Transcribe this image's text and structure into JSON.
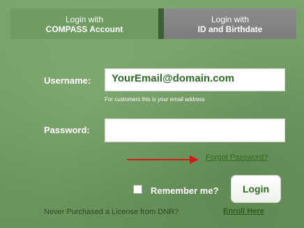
{
  "tabs": {
    "compass": {
      "line1": "Login with",
      "line2": "COMPASS Account"
    },
    "id_birthdate": {
      "line1": "Login with",
      "line2": "ID and Birthdate"
    }
  },
  "form": {
    "username_label": "Username:",
    "username_value": "YourEmail@domain.com",
    "username_hint": "For customers this is your email address",
    "password_label": "Password:",
    "password_value": "",
    "forgot_link": "Forgot Password?",
    "remember_label": "Remember me?",
    "remember_checked": false,
    "login_button": "Login"
  },
  "footer": {
    "prompt": "Never Purchased a License from DNR?",
    "enroll_link": "Enroll Here"
  },
  "colors": {
    "background": "#6e9761",
    "active_tab": "#709b63",
    "inactive_tab": "#858585",
    "arrow": "#d11a1a",
    "link": "#2f6d1f"
  }
}
